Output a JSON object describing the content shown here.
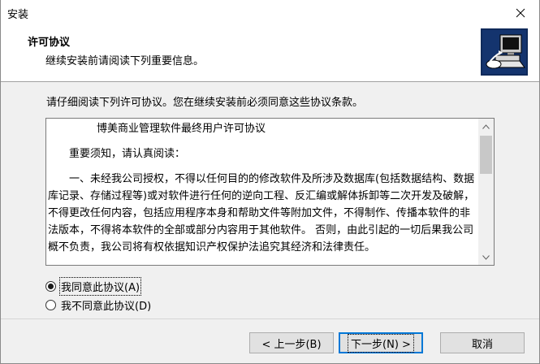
{
  "window": {
    "title": "安装"
  },
  "header": {
    "title": "许可协议",
    "subtitle": "继续安装前请阅读下列重要信息。",
    "icon": "installer-computer-icon"
  },
  "main": {
    "intro": "请仔细阅读下列许可协议。您在继续安装前必须同意这些协议条款。",
    "license": {
      "title": "博美商业管理软件最终用户许可协议",
      "notice": "重要须知，请认真阅读：",
      "body": "一、未经我公司授权，不得以任何目的的修改软件及所涉及数据库(包括数据结构、数据库记录、存储过程等)或对软件进行任何的逆向工程、反汇编或解体拆卸等二次开发及破解，不得更改任何内容，包括应用程序本身和帮助文件等附加文件，不得制作、传播本软件的非法版本，不得将本软件的全部或部分内容用于其他软件。 否则，由此引起的一切后果我公司概不负责，我公司将有权依据知识产权保护法追究其经济和法律责任。"
    },
    "options": {
      "accept": "我同意此协议(A)",
      "decline": "我不同意此协议(D)",
      "selected": "accept"
    }
  },
  "footer": {
    "back_label": "< 上一步(B)",
    "next_label": "下一步(N) >",
    "cancel_label": "取消"
  },
  "colors": {
    "background": "#f0f0f0",
    "header_bg": "#ffffff",
    "focus_border": "#0078d7"
  }
}
